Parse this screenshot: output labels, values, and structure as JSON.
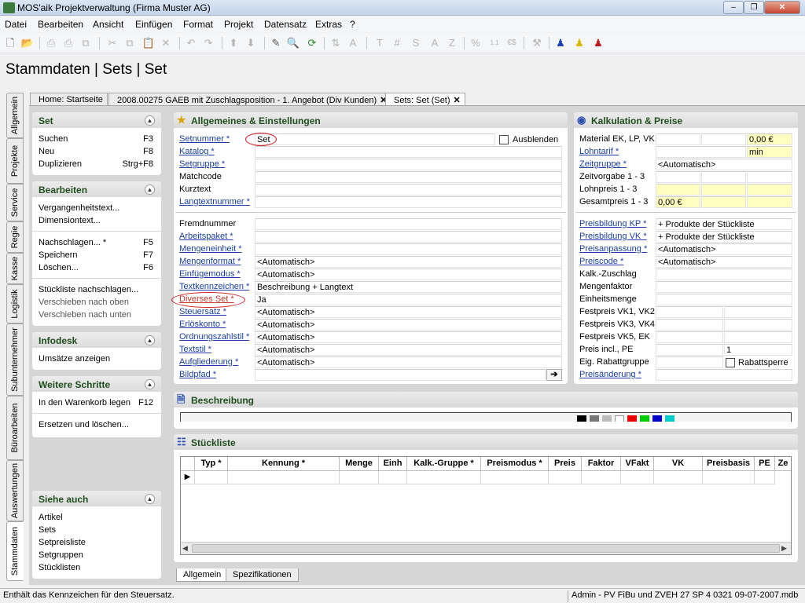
{
  "window": {
    "title": "MOS'aik Projektverwaltung (Firma Muster AG)",
    "minimize": "–",
    "maximize": "❐",
    "close": "✕"
  },
  "menu": [
    "Datei",
    "Bearbeiten",
    "Ansicht",
    "Einfügen",
    "Format",
    "Projekt",
    "Datensatz",
    "Extras",
    "?"
  ],
  "page_title": "Stammdaten | Sets | Set",
  "side_tabs": [
    "Allgemein",
    "Projekte",
    "Service",
    "Regie",
    "Kasse",
    "Logistik",
    "Subunternehmer",
    "Büroarbeiten",
    "Auswertungen",
    "Stammdaten"
  ],
  "doc_tabs": [
    {
      "label": "Home: Startseite"
    },
    {
      "label": "2008.00275 GAEB mit Zuschlagsposition - 1. Angebot (Div Kunden)"
    },
    {
      "label": "Sets: Set (Set)"
    }
  ],
  "left_panels": {
    "set": {
      "title": "Set",
      "items": [
        {
          "label": "Suchen",
          "shortcut": "F3"
        },
        {
          "label": "Neu",
          "shortcut": "F8"
        },
        {
          "label": "Duplizieren",
          "shortcut": "Strg+F8"
        }
      ]
    },
    "bearbeiten": {
      "title": "Bearbeiten",
      "items": [
        {
          "label": "Vergangenheitstext...",
          "shortcut": ""
        },
        {
          "label": "Dimensiontext...",
          "shortcut": ""
        },
        {
          "label": "Nachschlagen... *",
          "shortcut": "F5"
        },
        {
          "label": "Speichern",
          "shortcut": "F7"
        },
        {
          "label": "Löschen...",
          "shortcut": "F6"
        },
        {
          "label": "Stückliste nachschlagen...",
          "shortcut": ""
        },
        {
          "label": "Verschieben nach oben",
          "shortcut": ""
        },
        {
          "label": "Verschieben nach unten",
          "shortcut": ""
        }
      ]
    },
    "infodesk": {
      "title": "Infodesk",
      "items": [
        {
          "label": "Umsätze anzeigen"
        }
      ]
    },
    "weitere": {
      "title": "Weitere Schritte",
      "items": [
        {
          "label": "In den Warenkorb legen",
          "shortcut": "F12"
        },
        {
          "label": "Ersetzen und löschen...",
          "shortcut": ""
        }
      ]
    },
    "siehe": {
      "title": "Siehe auch",
      "items": [
        "Artikel",
        "Sets",
        "Setpreisliste",
        "Setgruppen",
        "Stücklisten"
      ]
    }
  },
  "allgemeines": {
    "title": "Allgemeines & Einstellungen",
    "ausblenden": "Ausblenden",
    "fields": [
      {
        "label": "Setnummer *",
        "value": "Set"
      },
      {
        "label": "Katalog *",
        "value": ""
      },
      {
        "label": "Setgruppe *",
        "value": ""
      },
      {
        "label": "Matchcode",
        "value": ""
      },
      {
        "label": "Kurztext",
        "value": ""
      },
      {
        "label": "Langtextnummer *",
        "value": ""
      },
      {
        "label": "Fremdnummer",
        "value": ""
      },
      {
        "label": "Arbeitspaket *",
        "value": ""
      },
      {
        "label": "Mengeneinheit *",
        "value": ""
      },
      {
        "label": "Mengenformat *",
        "value": "<Automatisch>"
      },
      {
        "label": "Einfügemodus *",
        "value": "<Automatisch>"
      },
      {
        "label": "Textkennzeichen *",
        "value": "Beschreibung + Langtext"
      },
      {
        "label": "Diverses Set *",
        "value": "Ja"
      },
      {
        "label": "Steuersatz *",
        "value": "<Automatisch>"
      },
      {
        "label": "Erlöskonto *",
        "value": "<Automatisch>"
      },
      {
        "label": "Ordnungszahlstil *",
        "value": "<Automatisch>"
      },
      {
        "label": "Textstil *",
        "value": "<Automatisch>"
      },
      {
        "label": "Aufgliederung *",
        "value": "<Automatisch>"
      },
      {
        "label": "Bildpfad *",
        "value": ""
      }
    ]
  },
  "kalkulation": {
    "title": "Kalkulation & Preise",
    "rabattsperre": "Rabattsperre",
    "fields": [
      {
        "label": "Material EK, LP, VK",
        "v1": "",
        "v2": "",
        "v3": "0,00 €"
      },
      {
        "label": "Lohntarif *",
        "v1": "",
        "v2": "min"
      },
      {
        "label": "Zeitgruppe *",
        "value": "<Automatisch>"
      },
      {
        "label": "Zeitvorgabe 1 - 3",
        "value": ""
      },
      {
        "label": "Lohnpreis 1 - 3",
        "value": ""
      },
      {
        "label": "Gesamtpreis 1 - 3",
        "value": "0,00 €"
      },
      {
        "label": "Preisbildung KP *",
        "value": "+ Produkte der Stückliste"
      },
      {
        "label": "Preisbildung VK *",
        "value": "+ Produkte der Stückliste"
      },
      {
        "label": "Preisanpassung *",
        "value": "<Automatisch>"
      },
      {
        "label": "Preiscode *",
        "value": "<Automatisch>"
      },
      {
        "label": "Kalk.-Zuschlag",
        "value": ""
      },
      {
        "label": "Mengenfaktor",
        "value": ""
      },
      {
        "label": "Einheitsmenge",
        "value": ""
      },
      {
        "label": "Festpreis VK1, VK2",
        "value": ""
      },
      {
        "label": "Festpreis VK3, VK4",
        "value": ""
      },
      {
        "label": "Festpreis VK5, EK",
        "value": ""
      },
      {
        "label": "Preis incl., PE",
        "value": "1"
      },
      {
        "label": "Eig. Rabattgruppe",
        "value": ""
      },
      {
        "label": "Preisänderung *",
        "value": ""
      }
    ]
  },
  "beschreibung": {
    "title": "Beschreibung"
  },
  "stueckliste": {
    "title": "Stückliste",
    "columns": [
      "Typ *",
      "Kennung *",
      "Menge",
      "Einh",
      "Kalk.-Gruppe *",
      "Preismodus *",
      "Preis",
      "Faktor",
      "VFakt",
      "VK",
      "Preisbasis",
      "PE",
      "Ze"
    ]
  },
  "bottom_tabs": [
    "Allgemein",
    "Spezifikationen"
  ],
  "status": {
    "left": "Enthält das Kennzeichen für den Steuersatz.",
    "right": "Admin - PV FiBu und ZVEH 27 SP 4 0321 09-07-2007.mdb"
  },
  "colors": {
    "accent_green": "#1f4f1f",
    "required_link": "#1a3fa0",
    "highlight_yellow": "#ffffc0",
    "annotation_red": "#d0191c"
  }
}
